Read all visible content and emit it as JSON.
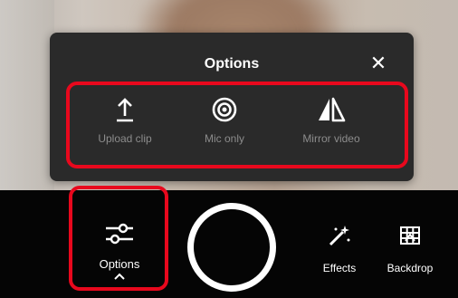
{
  "popup": {
    "title": "Options",
    "close_icon": "close-icon",
    "items": [
      {
        "label": "Upload clip",
        "icon": "upload-icon"
      },
      {
        "label": "Mic only",
        "icon": "target-icon"
      },
      {
        "label": "Mirror video",
        "icon": "mirror-icon"
      }
    ]
  },
  "toolbar": {
    "options_label": "Options",
    "options_icon": "sliders-icon",
    "record_icon": "record-button-icon",
    "effects_label": "Effects",
    "effects_icon": "magic-wand-icon",
    "backdrop_label": "Backdrop",
    "backdrop_icon": "backdrop-icon"
  },
  "colors": {
    "highlight": "#e8081d",
    "popup_bg": "#2a2a2a",
    "muted_label": "#8c8c8c"
  }
}
